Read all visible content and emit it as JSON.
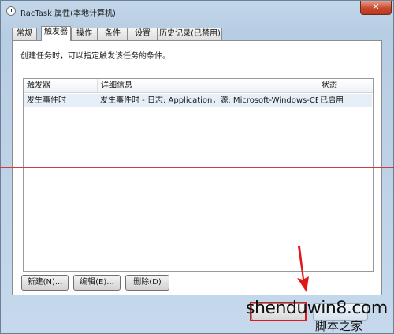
{
  "window": {
    "title": "RacTask 属性(本地计算机)",
    "close_glyph": "✕"
  },
  "tabs": [
    "常规",
    "触发器",
    "操作",
    "条件",
    "设置",
    "历史记录(已禁用)"
  ],
  "active_tab_index": 1,
  "panel": {
    "description": "创建任务时，可以指定触发该任务的条件。"
  },
  "list": {
    "columns": [
      "触发器",
      "详细信息",
      "状态"
    ],
    "rows": [
      {
        "trigger": "发生事件时",
        "details": "发生事件时 - 日志: Application，源: Microsoft-Windows-CEI...",
        "status": "已启用"
      }
    ]
  },
  "buttons": {
    "new": "新建(N)...",
    "edit": "编辑(E)...",
    "delete": "删除(D)"
  },
  "watermark": {
    "line1": "shenduwin8.com",
    "line2": "脚本之家"
  },
  "colors": {
    "annotation_red": "#e01818",
    "selection": "#e6eef8"
  }
}
